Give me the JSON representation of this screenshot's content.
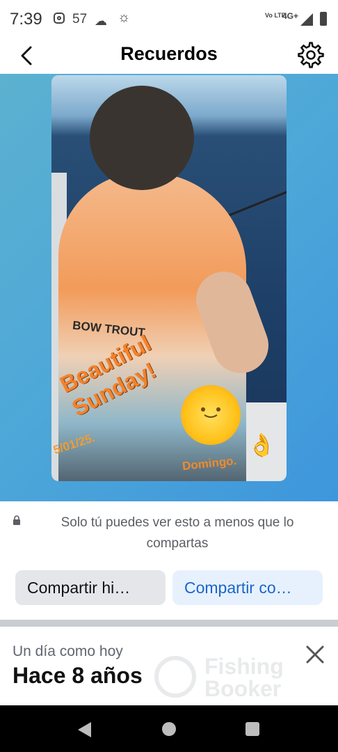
{
  "status_bar": {
    "time": "7:39",
    "temperature": "57",
    "icons": [
      "instagram-icon",
      "cloud-icon",
      "weather-spark-icon",
      "volte-icon",
      "signal-icon",
      "battery-icon"
    ],
    "volte_label": "Vo LTE",
    "network_label": "4G+"
  },
  "header": {
    "title": "Recuerdos",
    "back_icon": "back-arrow-icon",
    "settings_icon": "gear-icon"
  },
  "memory": {
    "overlay_text": "Beautiful\nSunday!",
    "date_text": "5/01/25.",
    "caption_text": "Domingo.",
    "shirt_text": "BOW TROUT",
    "emojis": [
      "sun-face-emoji",
      "ok-hand-emoji"
    ]
  },
  "privacy": {
    "text": "Solo tú puedes ver esto a menos que lo compartas"
  },
  "buttons": {
    "share_story": "Compartir hi…",
    "share_with": "Compartir co…"
  },
  "footer": {
    "label": "Un día como hoy",
    "years": "Hace 8 años",
    "watermark_line1": "Fishing",
    "watermark_line2": "Booker"
  },
  "colors": {
    "accent_blue": "#1a66c9",
    "memory_bg": "#4da7d8",
    "overlay_orange": "#f4822a"
  }
}
